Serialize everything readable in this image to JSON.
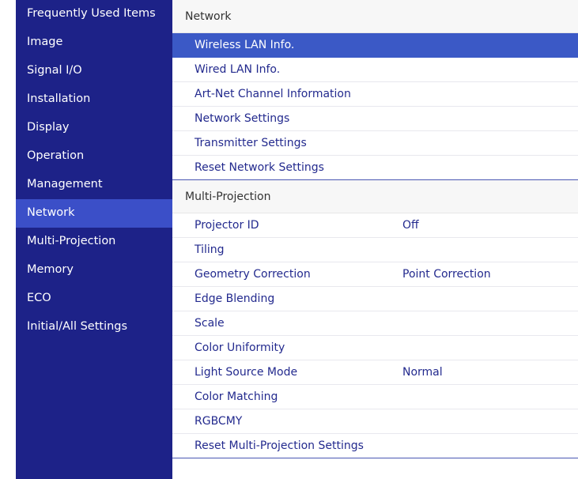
{
  "sidebar": {
    "items": [
      {
        "label": "Frequently Used Items"
      },
      {
        "label": "Image"
      },
      {
        "label": "Signal I/O"
      },
      {
        "label": "Installation"
      },
      {
        "label": "Display"
      },
      {
        "label": "Operation"
      },
      {
        "label": "Management"
      },
      {
        "label": "Network",
        "active": true
      },
      {
        "label": "Multi-Projection"
      },
      {
        "label": "Memory"
      },
      {
        "label": "ECO"
      },
      {
        "label": "Initial/All Settings"
      }
    ]
  },
  "main": {
    "network": {
      "title": "Network",
      "items": [
        {
          "label": "Wireless LAN Info.",
          "selected": true
        },
        {
          "label": "Wired LAN Info."
        },
        {
          "label": "Art-Net Channel Information"
        },
        {
          "label": "Network Settings"
        },
        {
          "label": "Transmitter Settings"
        },
        {
          "label": "Reset Network Settings"
        }
      ]
    },
    "multi_projection": {
      "title": "Multi-Projection",
      "items": [
        {
          "label": "Projector ID",
          "value": "Off"
        },
        {
          "label": "Tiling"
        },
        {
          "label": "Geometry Correction",
          "value": "Point Correction"
        },
        {
          "label": "Edge Blending"
        },
        {
          "label": "Scale"
        },
        {
          "label": "Color Uniformity"
        },
        {
          "label": "Light Source Mode",
          "value": "Normal"
        },
        {
          "label": "Color Matching"
        },
        {
          "label": "RGBCMY"
        },
        {
          "label": "Reset Multi-Projection Settings"
        }
      ]
    }
  },
  "colors": {
    "sidebar_bg": "#1d2288",
    "sidebar_active": "#3b4fc8",
    "selected_row": "#3b59c6",
    "item_text": "#232a8e"
  }
}
